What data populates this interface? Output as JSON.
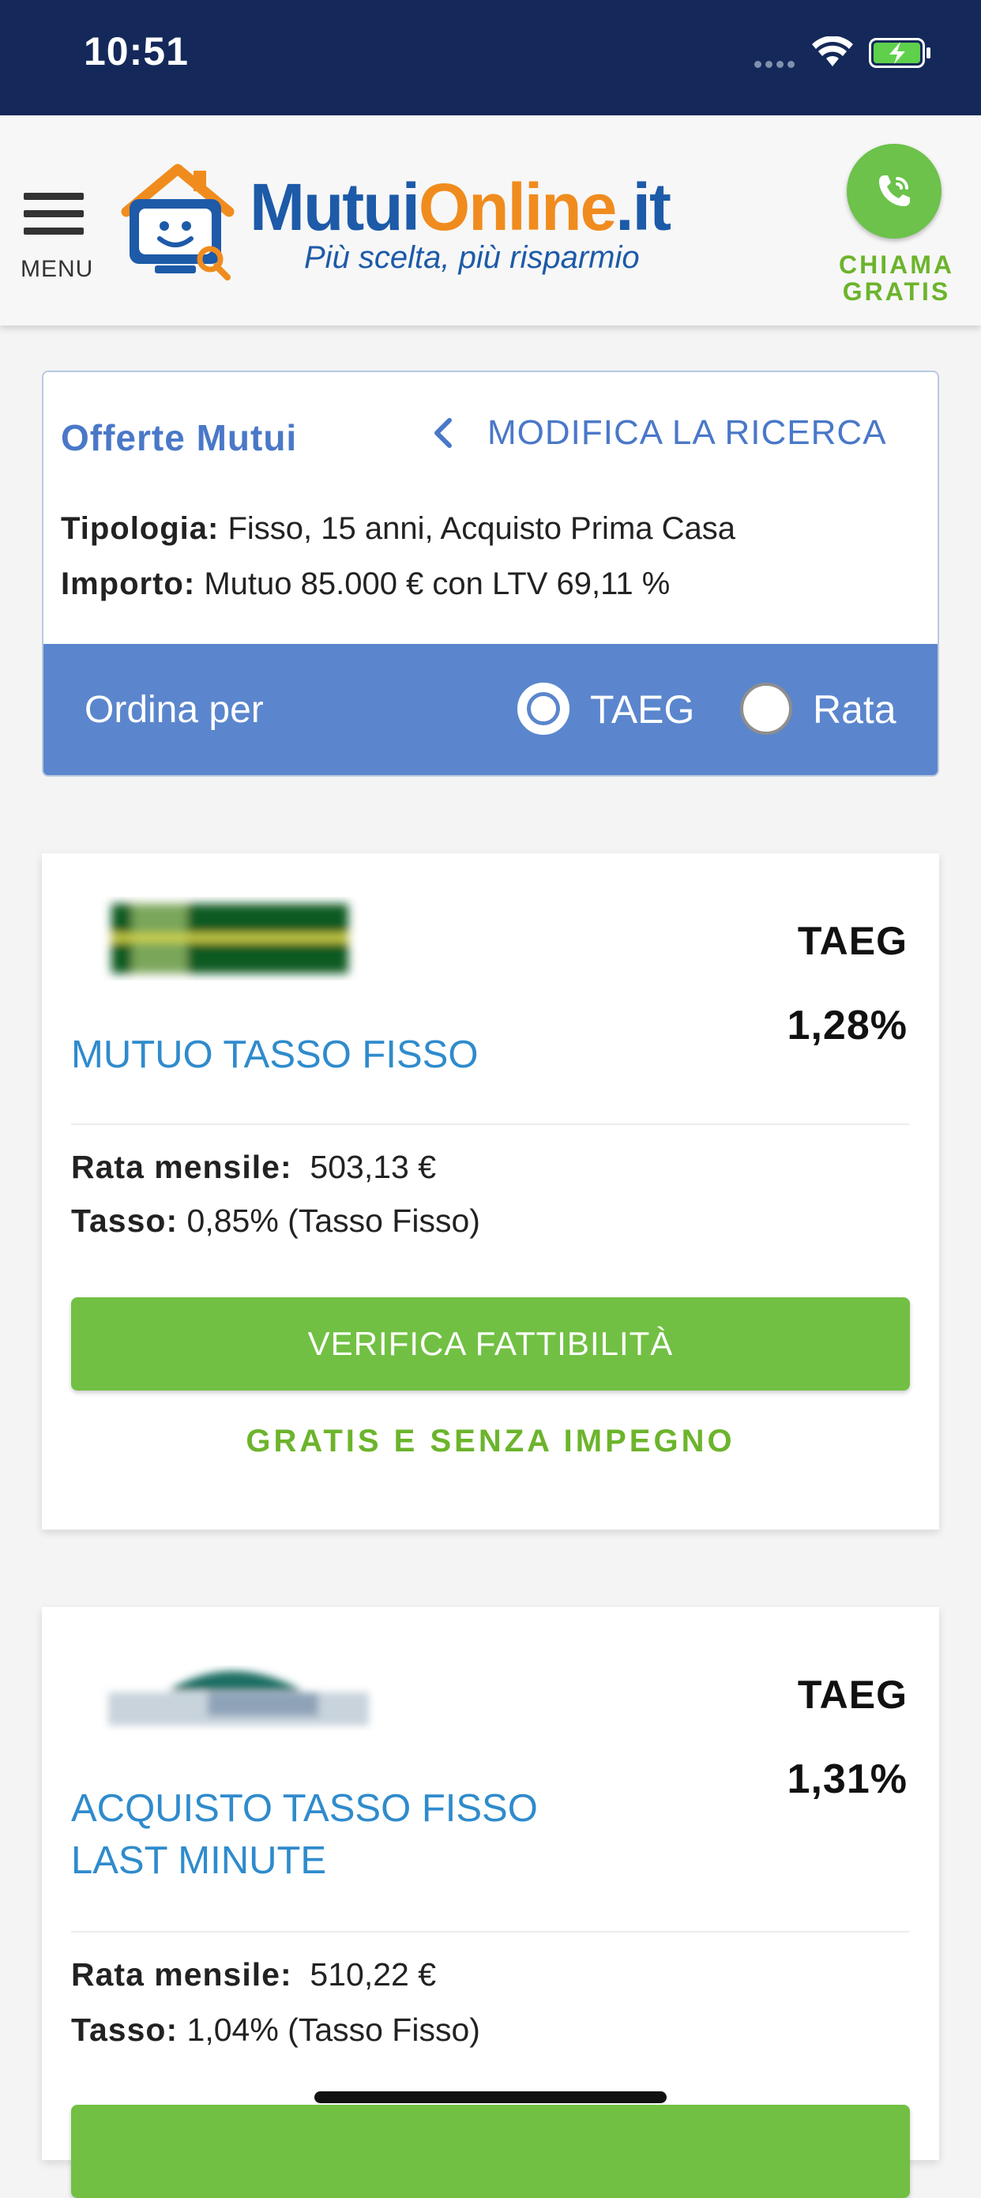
{
  "status_bar": {
    "time": "10:51"
  },
  "header": {
    "menu_label": "MENU",
    "logo_part1": "Mutui",
    "logo_part2": "Online",
    "logo_part3": ".it",
    "tagline": "Più scelta, più risparmio",
    "call_label_line1": "CHIAMA",
    "call_label_line2": "GRATIS"
  },
  "search": {
    "title": "Offerte Mutui",
    "modify_label": "MODIFICA LA RICERCA",
    "type_label": "Tipologia:",
    "type_value": "Fisso, 15 anni, Acquisto Prima Casa",
    "amount_label": "Importo:",
    "amount_value": "Mutuo 85.000 € con LTV 69,11 %",
    "sort_label": "Ordina per",
    "sort_options": [
      "TAEG",
      "Rata"
    ],
    "sort_selected": "TAEG"
  },
  "offers": [
    {
      "product": "MUTUO TASSO FISSO",
      "taeg_label": "TAEG",
      "taeg_value": "1,28%",
      "rate_label": "Rata mensile:",
      "rate_value": "503,13 €",
      "interest_label": "Tasso:",
      "interest_value": "0,85% (Tasso Fisso)",
      "cta": "VERIFICA FATTIBILITÀ",
      "cta_note": "GRATIS E SENZA IMPEGNO"
    },
    {
      "product_line1": "ACQUISTO TASSO FISSO",
      "product_line2": "LAST MINUTE",
      "taeg_label": "TAEG",
      "taeg_value": "1,31%",
      "rate_label": "Rata mensile:",
      "rate_value": "510,22 €",
      "interest_label": "Tasso:",
      "interest_value": "1,04% (Tasso Fisso)"
    }
  ],
  "colors": {
    "status_bar": "#14295a",
    "brand_blue": "#1d5aa8",
    "brand_orange": "#f08c1e",
    "sort_bar": "#5b86cd",
    "cta_green": "#71c043",
    "link_blue": "#2f8bcc"
  }
}
